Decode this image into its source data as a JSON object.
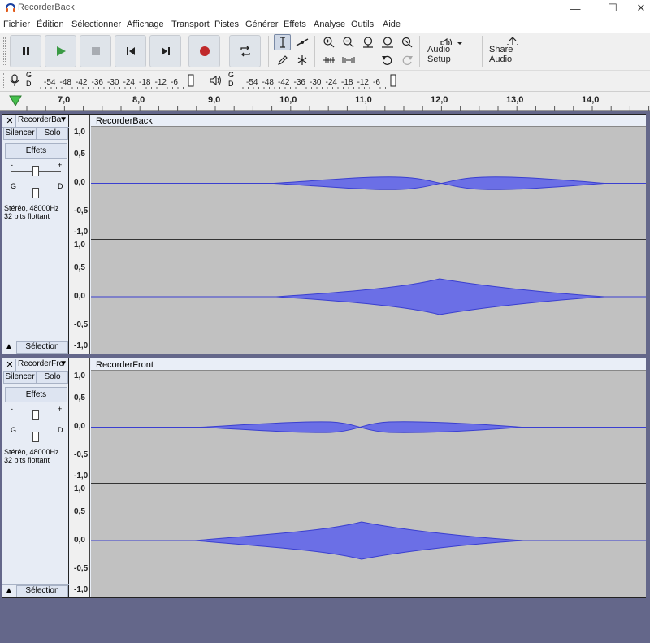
{
  "window": {
    "title": "RecorderBack"
  },
  "menu": [
    "Fichier",
    "Édition",
    "Sélectionner",
    "Affichage",
    "Transport",
    "Pistes",
    "Générer",
    "Effets",
    "Analyse",
    "Outils",
    "Aide"
  ],
  "toolbar": {
    "audio_setup_label": "Audio Setup",
    "share_audio_label": "Share Audio"
  },
  "meters": {
    "record_scale": [
      "-54",
      "-48",
      "-42",
      "-36",
      "-30",
      "-24",
      "-18",
      "-12",
      "-6"
    ],
    "playback_scale": [
      "-54",
      "-48",
      "-42",
      "-36",
      "-30",
      "-24",
      "-18",
      "-12",
      "-6"
    ],
    "channel_labels": [
      "G",
      "D"
    ]
  },
  "timeline": {
    "labels": [
      "7,0",
      "8,0",
      "9,0",
      "10,0",
      "11,0",
      "12,0",
      "13,0",
      "14,0"
    ]
  },
  "tracks": [
    {
      "short_name": "RecorderBa",
      "clip_name": "RecorderBack",
      "mute": "Silencer",
      "solo": "Solo",
      "effects": "Effets",
      "gain_minus": "-",
      "gain_plus": "+",
      "pan_left": "G",
      "pan_right": "D",
      "info_line1": "Stéréo, 48000Hz",
      "info_line2": "32 bits flottant",
      "select": "Sélection"
    },
    {
      "short_name": "RecorderFro",
      "clip_name": "RecorderFront",
      "mute": "Silencer",
      "solo": "Solo",
      "effects": "Effets",
      "gain_minus": "-",
      "gain_plus": "+",
      "pan_left": "G",
      "pan_right": "D",
      "info_line1": "Stéréo, 48000Hz",
      "info_line2": "32 bits flottant",
      "select": "Sélection"
    }
  ],
  "ruler_labels": [
    "1,0",
    "0,5",
    "0,0",
    "-0,5",
    "-1,0"
  ],
  "colors": {
    "waveform": "#3a3fd0",
    "waveform_rms": "#6b6fe6",
    "background": "#c1c1c1",
    "record": "#c0292b",
    "play": "#3a9a44"
  }
}
